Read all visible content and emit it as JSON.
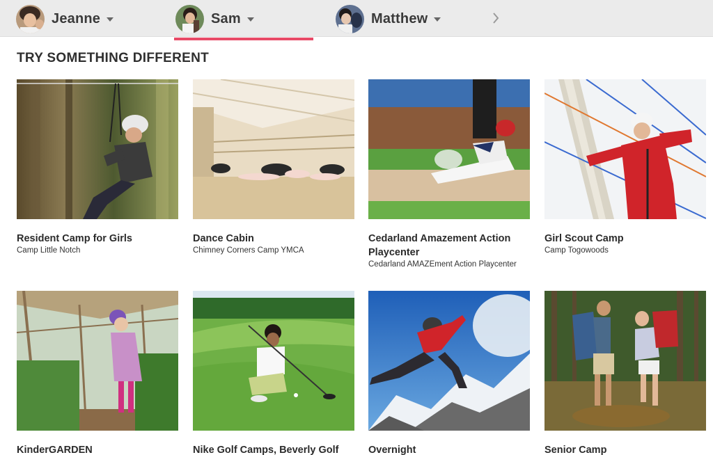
{
  "profiles": [
    {
      "name": "Jeanne",
      "active": false
    },
    {
      "name": "Sam",
      "active": true
    },
    {
      "name": "Matthew",
      "active": false
    }
  ],
  "section": {
    "title": "TRY SOMETHING DIFFERENT"
  },
  "cards": [
    {
      "title": "Resident Camp for Girls",
      "subtitle": "Camp Little Notch"
    },
    {
      "title": "Dance Cabin",
      "subtitle": "Chimney Corners Camp YMCA"
    },
    {
      "title": "Cedarland Amazement Action Playcenter",
      "subtitle": "Cedarland AMAZEment Action Playcenter"
    },
    {
      "title": "Girl Scout Camp",
      "subtitle": "Camp Togowoods"
    },
    {
      "title": "KinderGARDEN",
      "subtitle": ""
    },
    {
      "title": "Nike Golf Camps, Beverly Golf",
      "subtitle": ""
    },
    {
      "title": "Overnight",
      "subtitle": ""
    },
    {
      "title": "Senior Camp",
      "subtitle": ""
    }
  ],
  "colors": {
    "active_tab_underline": "#e84a67",
    "topbar_bg": "#ebebeb"
  }
}
